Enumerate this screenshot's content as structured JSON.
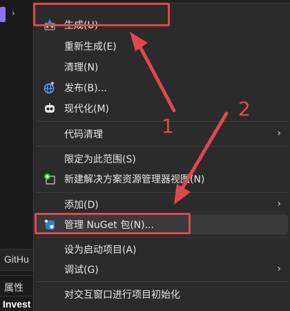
{
  "side": {
    "github_label": "GitHu",
    "props_label": "属性",
    "invest_label": "Invest"
  },
  "menu": {
    "items": [
      {
        "label": "生成(U)",
        "icon": "build-icon"
      },
      {
        "label": "重新生成(E)"
      },
      {
        "label": "清理(N)"
      },
      {
        "label": "发布(B)...",
        "icon": "publish-globe-icon"
      },
      {
        "label": "现代化(M)",
        "icon": "modernize-icon"
      },
      {
        "label": "代码清理",
        "submenu": true
      },
      {
        "label": "限定为此范围(S)"
      },
      {
        "label": "新建解决方案资源管理器视图(N)",
        "icon": "new-view-icon"
      },
      {
        "label": "添加(D)",
        "submenu": true
      },
      {
        "label": "管理 NuGet 包(N)...",
        "icon": "nuget-icon"
      },
      {
        "label": "设为启动项目(A)"
      },
      {
        "label": "调试(G)",
        "submenu": true
      },
      {
        "label": "对交互窗口进行项目初始化"
      }
    ]
  },
  "annotations": {
    "num1": "1",
    "num2": "2",
    "color": "#e0484e"
  }
}
